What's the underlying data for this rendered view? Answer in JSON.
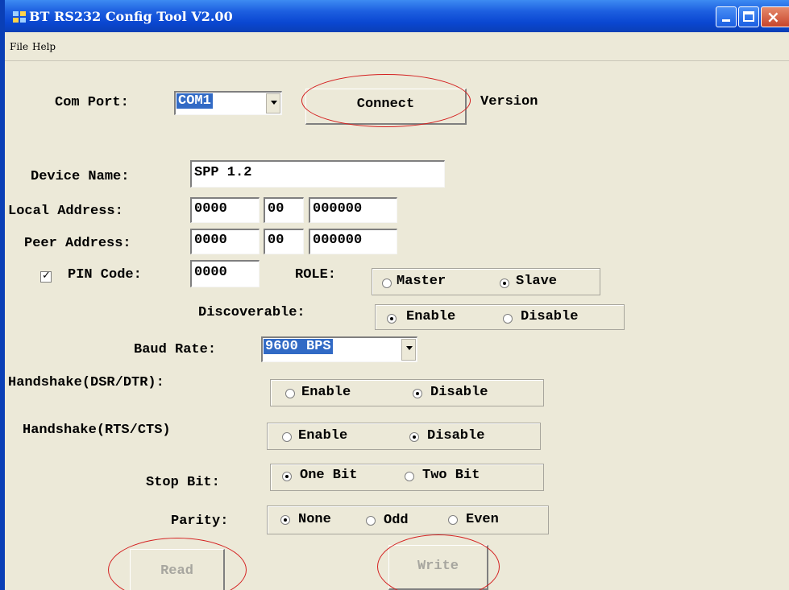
{
  "window": {
    "title": "BT RS232 Config Tool  V2.00"
  },
  "menu": {
    "file": "File",
    "help": "Help"
  },
  "com_port": {
    "label": "Com Port:",
    "value": "COM1"
  },
  "connect_label": "Connect",
  "version_label": "Version",
  "device_name": {
    "label": "Device Name:",
    "value": "SPP 1.2"
  },
  "local_address": {
    "label": "Local Address:",
    "part1": "0000",
    "part2": "00",
    "part3": "000000"
  },
  "peer_address": {
    "label": "Peer Address:",
    "part1": "0000",
    "part2": "00",
    "part3": "000000"
  },
  "pin": {
    "label": "PIN Code:",
    "value": "0000",
    "checked": true
  },
  "role": {
    "label": "ROLE:",
    "master": "Master",
    "slave": "Slave",
    "selected": "Slave"
  },
  "discoverable": {
    "label": "Discoverable:",
    "enable": "Enable",
    "disable": "Disable",
    "selected": "Enable"
  },
  "baud_rate": {
    "label": "Baud Rate:",
    "value": "9600 BPS"
  },
  "handshake_dsr": {
    "label": "Handshake(DSR/DTR):",
    "enable": "Enable",
    "disable": "Disable",
    "selected": "Disable"
  },
  "handshake_rts": {
    "label": "Handshake(RTS/CTS)",
    "enable": "Enable",
    "disable": "Disable",
    "selected": "Disable"
  },
  "stop_bit": {
    "label": "Stop Bit:",
    "one": "One Bit",
    "two": "Two Bit",
    "selected": "One Bit"
  },
  "parity": {
    "label": "Parity:",
    "none": "None",
    "odd": "Odd",
    "even": "Even",
    "selected": "None"
  },
  "read_label": "Read",
  "write_label": "Write",
  "colors": {
    "titlebar": "#0a47d1",
    "window_bg": "#ece9d8",
    "selection": "#316ac5",
    "annotation_oval": "#d42020"
  }
}
